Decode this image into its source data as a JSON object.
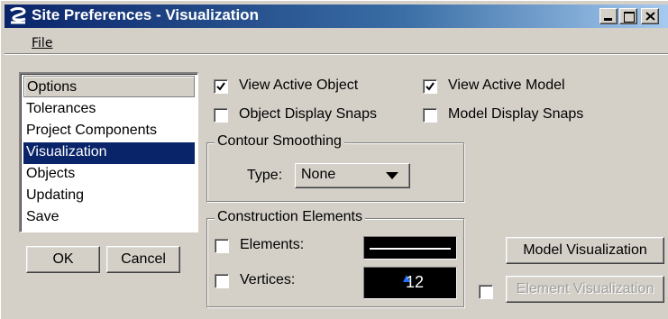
{
  "window": {
    "title": "Site Preferences - Visualization",
    "titlebar_buttons": [
      "minimize",
      "maximize",
      "close"
    ]
  },
  "menu": {
    "file": "File"
  },
  "options_list": {
    "header": "Options",
    "items": [
      "Tolerances",
      "Project Components",
      "Visualization",
      "Objects",
      "Updating",
      "Save"
    ],
    "selected": "Visualization"
  },
  "buttons": {
    "ok": "OK",
    "cancel": "Cancel",
    "model_visualization": "Model Visualization",
    "element_visualization": "Element Visualization"
  },
  "checkboxes": {
    "view_active_object": {
      "label": "View Active Object",
      "checked": true
    },
    "view_active_model": {
      "label": "View Active Model",
      "checked": true
    },
    "object_display_snaps": {
      "label": "Object Display Snaps",
      "checked": false
    },
    "model_display_snaps": {
      "label": "Model Display Snaps",
      "checked": false
    },
    "element_visualization_toggle": {
      "checked": false
    }
  },
  "contour_smoothing": {
    "group_label": "Contour Smoothing",
    "type_label": "Type:",
    "type_value": "None"
  },
  "construction_elements": {
    "group_label": "Construction Elements",
    "elements": {
      "label": "Elements:",
      "checked": false
    },
    "vertices": {
      "label": "Vertices:",
      "checked": false,
      "value": "12"
    }
  },
  "colors": {
    "title_gradient_start": "#0a246a",
    "title_gradient_end": "#a6caf0",
    "selection": "#0a246a",
    "face": "#d4d0c8",
    "vertex_marker": "#1f6fff"
  }
}
